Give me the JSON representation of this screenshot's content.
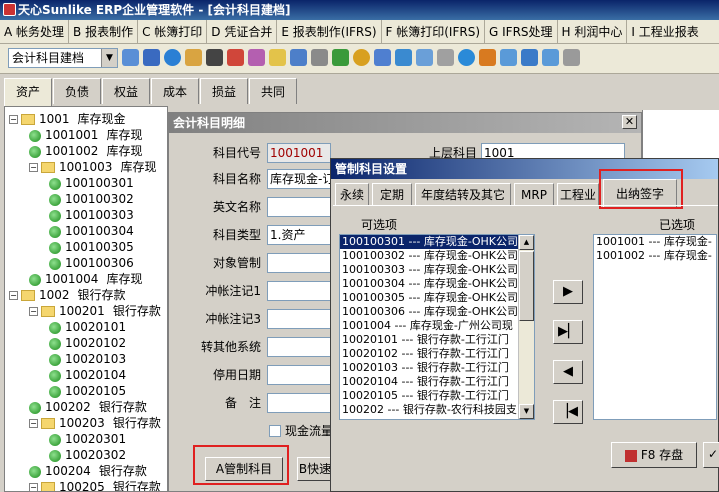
{
  "window": {
    "title": "天心Sunlike ERP企业管理软件 - [会计科目建档]"
  },
  "menu": [
    "A 帐务处理",
    "B 报表制作",
    "C 帐簿打印",
    "D 凭证合并",
    "E 报表制作(IFRS)",
    "F 帐簿打印(IFRS)",
    "G IFRS处理",
    "H 利润中心",
    "I 工程业报表"
  ],
  "toolbar": {
    "combo_value": "会计科目建档"
  },
  "tabs": [
    "资产",
    "负债",
    "权益",
    "成本",
    "损益",
    "共同"
  ],
  "tree": [
    {
      "id": "1001",
      "name": "库存现金",
      "level": 0,
      "type": "folder",
      "expanded": true
    },
    {
      "id": "1001001",
      "name": "库存现",
      "level": 1,
      "type": "leaf"
    },
    {
      "id": "1001002",
      "name": "库存现",
      "level": 1,
      "type": "leaf"
    },
    {
      "id": "1001003",
      "name": "库存现",
      "level": 1,
      "type": "folder",
      "expanded": true
    },
    {
      "id": "100100301",
      "name": "",
      "level": 2,
      "type": "leaf"
    },
    {
      "id": "100100302",
      "name": "",
      "level": 2,
      "type": "leaf"
    },
    {
      "id": "100100303",
      "name": "",
      "level": 2,
      "type": "leaf"
    },
    {
      "id": "100100304",
      "name": "",
      "level": 2,
      "type": "leaf"
    },
    {
      "id": "100100305",
      "name": "",
      "level": 2,
      "type": "leaf"
    },
    {
      "id": "100100306",
      "name": "",
      "level": 2,
      "type": "leaf"
    },
    {
      "id": "1001004",
      "name": "库存现",
      "level": 1,
      "type": "leaf"
    },
    {
      "id": "1002",
      "name": "银行存款",
      "level": 0,
      "type": "folder",
      "expanded": true
    },
    {
      "id": "100201",
      "name": "银行存款",
      "level": 1,
      "type": "folder",
      "expanded": true
    },
    {
      "id": "10020101",
      "name": "",
      "level": 2,
      "type": "leaf"
    },
    {
      "id": "10020102",
      "name": "",
      "level": 2,
      "type": "leaf"
    },
    {
      "id": "10020103",
      "name": "",
      "level": 2,
      "type": "leaf"
    },
    {
      "id": "10020104",
      "name": "",
      "level": 2,
      "type": "leaf"
    },
    {
      "id": "10020105",
      "name": "",
      "level": 2,
      "type": "leaf"
    },
    {
      "id": "100202",
      "name": "银行存款",
      "level": 1,
      "type": "leaf"
    },
    {
      "id": "100203",
      "name": "银行存款",
      "level": 1,
      "type": "folder",
      "expanded": true
    },
    {
      "id": "10020301",
      "name": "",
      "level": 2,
      "type": "leaf"
    },
    {
      "id": "10020302",
      "name": "",
      "level": 2,
      "type": "leaf"
    },
    {
      "id": "100204",
      "name": "银行存款",
      "level": 1,
      "type": "leaf"
    },
    {
      "id": "100205",
      "name": "银行存款",
      "level": 1,
      "type": "folder",
      "expanded": true
    }
  ],
  "detail": {
    "title": "会计科目明细",
    "fields": [
      {
        "label": "科目代号",
        "value": "1001001"
      },
      {
        "label": "科目名称",
        "value": "库存现金-订"
      },
      {
        "label": "英文名称",
        "value": ""
      },
      {
        "label": "科目类型",
        "value": "1.资产"
      },
      {
        "label": "对象管制",
        "value": ""
      },
      {
        "label": "冲帐注记1",
        "value": ""
      },
      {
        "label": "冲帐注记3",
        "value": ""
      },
      {
        "label": "转其他系统",
        "value": ""
      },
      {
        "label": "停用日期",
        "value": ""
      },
      {
        "label": "备　注",
        "value": ""
      }
    ],
    "parent_label": "上层科目",
    "parent_value": "1001",
    "cash_flow_label": "现金流量",
    "buttons": {
      "control": "A管制科目",
      "quick": "B快速"
    }
  },
  "control_dialog": {
    "title": "管制科目设置",
    "tabs": [
      "永续",
      "定期",
      "年度结转及其它",
      "MRP",
      "工程业",
      "出纳签字"
    ],
    "available_label": "可选项",
    "selected_label": "已选项",
    "available": [
      "100100301 --- 库存现金-OHK公司",
      "100100302 --- 库存现金-OHK公司",
      "100100303 --- 库存现金-OHK公司",
      "100100304 --- 库存现金-OHK公司",
      "100100305 --- 库存现金-OHK公司",
      "100100306 --- 库存现金-OHK公司",
      "1001004 --- 库存现金-广州公司现",
      "10020101 --- 银行存款-工行江门",
      "10020102 --- 银行存款-工行江门",
      "10020103 --- 银行存款-工行江门",
      "10020104 --- 银行存款-工行江门",
      "10020105 --- 银行存款-工行江门",
      "100202 --- 银行存款-农行科技园支"
    ],
    "selected": [
      "1001001 --- 库存现金-",
      "1001002 --- 库存现金-"
    ],
    "buttons": {
      "save": "F8 存盘"
    }
  }
}
